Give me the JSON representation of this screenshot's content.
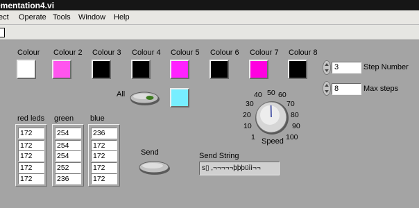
{
  "window": {
    "title": "ementation4.vi"
  },
  "menu": [
    "ect",
    "Operate",
    "Tools",
    "Window",
    "Help"
  ],
  "colours": [
    {
      "label": "Colour",
      "color": "#ffffff"
    },
    {
      "label": "Colour 2",
      "color": "#ff55ee"
    },
    {
      "label": "Colour 3",
      "color": "#000000"
    },
    {
      "label": "Colour 4",
      "color": "#000000"
    },
    {
      "label": "Colour 5",
      "color": "#ff22ff"
    },
    {
      "label": "Colour 6",
      "color": "#000000"
    },
    {
      "label": "Colour 7",
      "color": "#ff00e0"
    },
    {
      "label": "Colour 8",
      "color": "#000000"
    }
  ],
  "all": {
    "label": "All",
    "swatch_color": "#77eeff",
    "led_color": "#3c7a1e"
  },
  "step": {
    "value": "3",
    "label": "Step Number"
  },
  "max_steps": {
    "value": "8",
    "label": "Max steps"
  },
  "speed": {
    "label": "Speed",
    "ticks": [
      "1",
      "10",
      "20",
      "30",
      "40",
      "50",
      "60",
      "70",
      "80",
      "90",
      "100"
    ],
    "value": 50,
    "min": 1,
    "max": 100
  },
  "arrays": [
    {
      "label": "red leds",
      "values": [
        "172",
        "172",
        "172",
        "172",
        "172"
      ]
    },
    {
      "label": "green",
      "values": [
        "254",
        "254",
        "254",
        "252",
        "236"
      ]
    },
    {
      "label": "blue",
      "values": [
        "236",
        "172",
        "172",
        "172",
        "172"
      ]
    }
  ],
  "send": {
    "label": "Send"
  },
  "send_string": {
    "label": "Send String",
    "value": "s▯ ,¬¬¬¬¬þþþüìì¬¬"
  }
}
